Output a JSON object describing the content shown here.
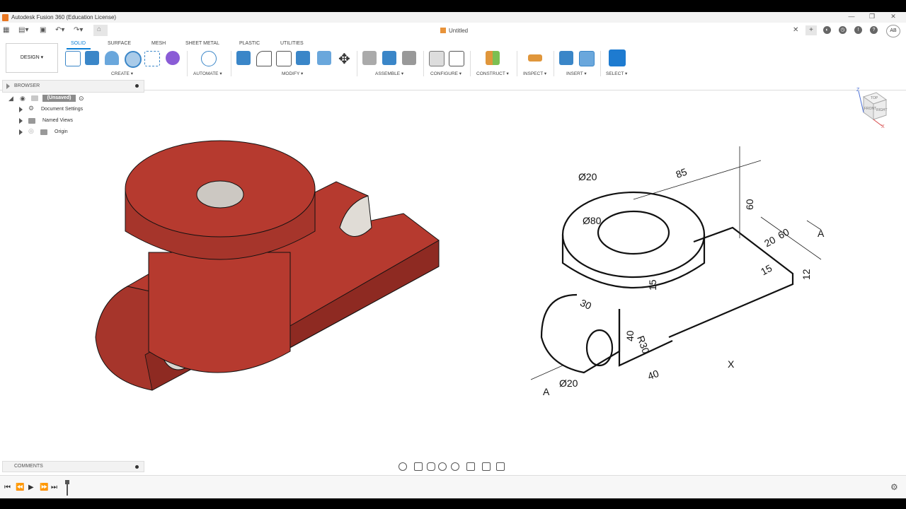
{
  "titlebar": {
    "title": "Autodesk Fusion 360 (Education License)"
  },
  "document": {
    "title": "Untitled"
  },
  "user": {
    "initials": "AB"
  },
  "ribbon": {
    "workspace": "DESIGN ▾",
    "tabs": [
      "SOLID",
      "SURFACE",
      "MESH",
      "SHEET METAL",
      "PLASTIC",
      "UTILITIES"
    ],
    "active_tab": "SOLID",
    "groups": [
      "CREATE ▾",
      "AUTOMATE ▾",
      "MODIFY ▾",
      "ASSEMBLE ▾",
      "CONFIGURE ▾",
      "CONSTRUCT ▾",
      "INSPECT ▾",
      "INSERT ▾",
      "SELECT ▾"
    ]
  },
  "browser": {
    "title": "BROWSER",
    "root": "(Unsaved)",
    "items": [
      "Document Settings",
      "Named Views",
      "Origin"
    ]
  },
  "comments": {
    "title": "COMMENTS"
  },
  "viewcube": {
    "labels": [
      "TOP",
      "FRONT",
      "RIGHT"
    ],
    "axes": [
      "Z",
      "X"
    ]
  },
  "drawing": {
    "dims": [
      "Ø20",
      "85",
      "60",
      "Ø80",
      "60",
      "20",
      "A",
      "15",
      "15",
      "12",
      "30",
      "40",
      "R30",
      "40",
      "Ø20",
      "A",
      "X"
    ]
  },
  "colors": {
    "accent": "#0a7ed6",
    "part": "#b63a2f",
    "part_dark": "#8e2a22"
  }
}
